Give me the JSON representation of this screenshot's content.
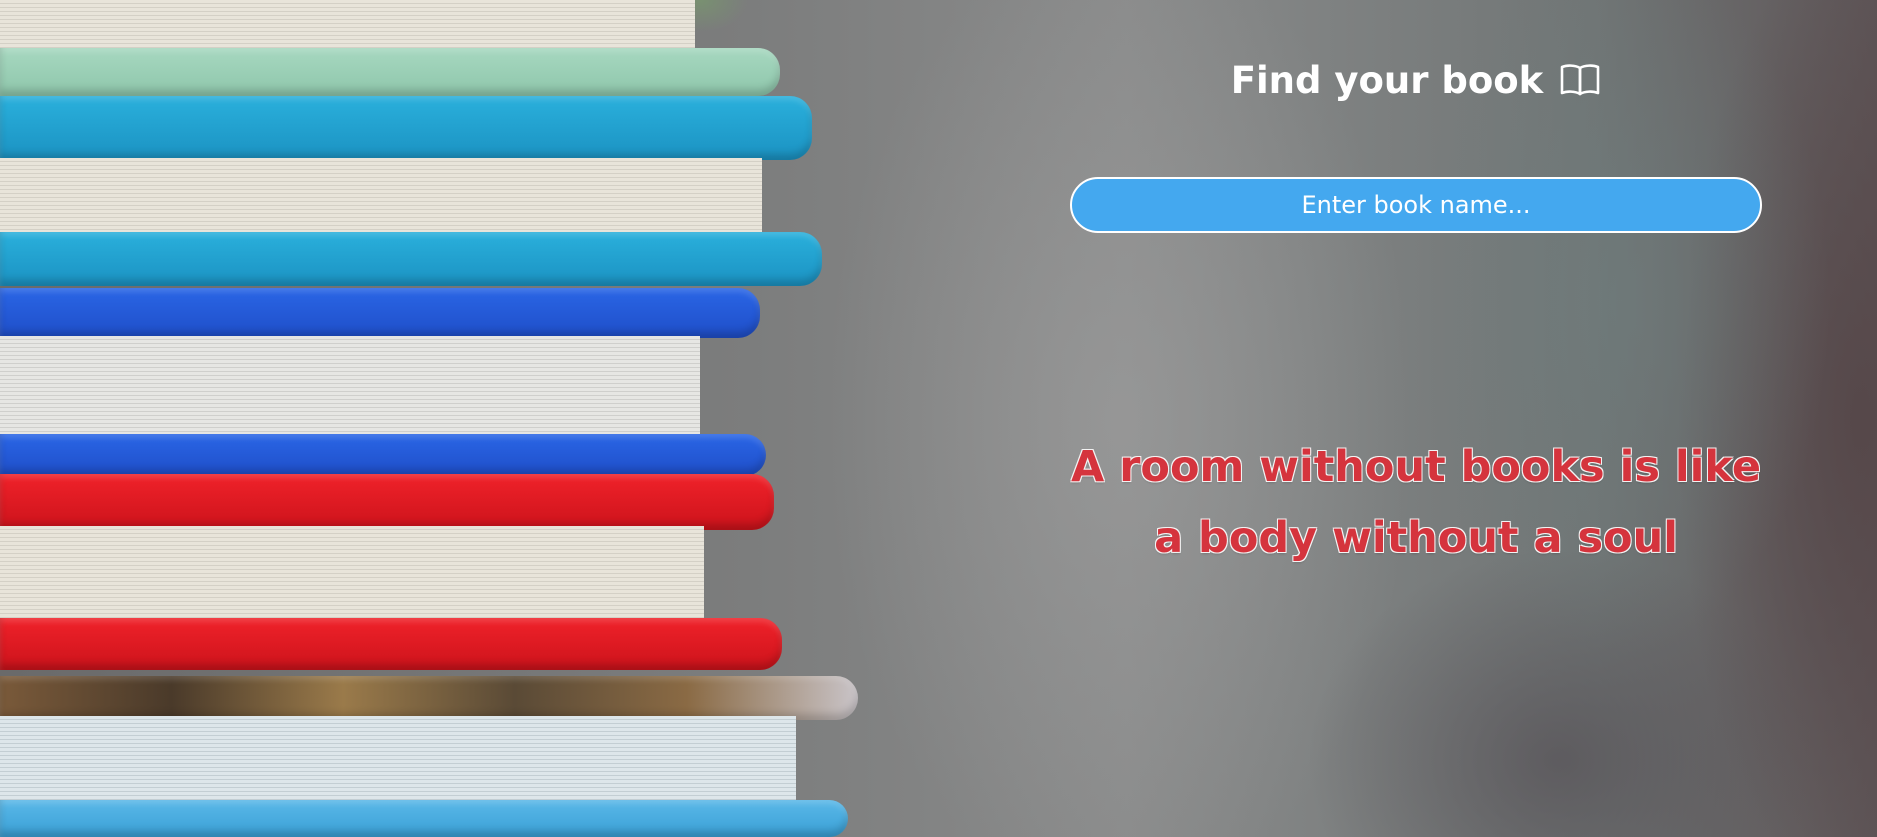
{
  "header": {
    "title": "Find your book",
    "title_icon": "open-book-icon"
  },
  "search": {
    "placeholder": "Enter book name...",
    "value": ""
  },
  "quote": {
    "line1": "A room without books is like",
    "line2": "a body without a soul"
  },
  "colors": {
    "search_background": "#44a8ef",
    "quote_text": "#d5343d",
    "title_text": "#ffffff"
  }
}
